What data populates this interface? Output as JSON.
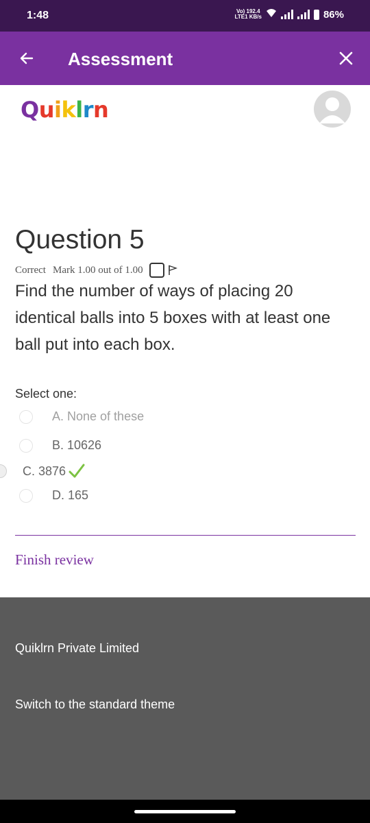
{
  "status_bar": {
    "time": "1:48",
    "network_top": "Vo) 192.4",
    "network_bottom": "LTE1 KB/s",
    "battery": "86%"
  },
  "app_bar": {
    "title": "Assessment",
    "back_icon": "arrow-left-icon",
    "close_icon": "close-icon"
  },
  "brand": {
    "logo_letters": [
      "Q",
      "u",
      "i",
      "k",
      "l",
      "r",
      "n"
    ],
    "avatar_icon": "user-avatar-icon"
  },
  "question": {
    "title": "Question 5",
    "state": "Correct",
    "mark": "Mark 1.00 out of 1.00",
    "text": "Find the number of ways of placing 20 identical balls into 5 boxes with at least one ball put into each box.",
    "flag_icon": "flag-icon"
  },
  "answers": {
    "prompt": "Select one:",
    "options": [
      {
        "label": "A. None of these",
        "selected": false
      },
      {
        "label": "B. 10626",
        "selected": false
      },
      {
        "label": "C. 3876",
        "selected": true,
        "correct": true
      },
      {
        "label": "D. 165",
        "selected": false
      }
    ],
    "check_icon": "checkmark-icon"
  },
  "finish_review": "Finish review",
  "footer": {
    "company": "Quiklrn Private Limited",
    "theme_link": "Switch to the standard theme"
  },
  "colors": {
    "status_bar": "#3a1750",
    "app_bar": "#7a31a0",
    "accent": "#7a31a0",
    "footer": "#5a5a5a",
    "correct_check": "#7cc242"
  }
}
